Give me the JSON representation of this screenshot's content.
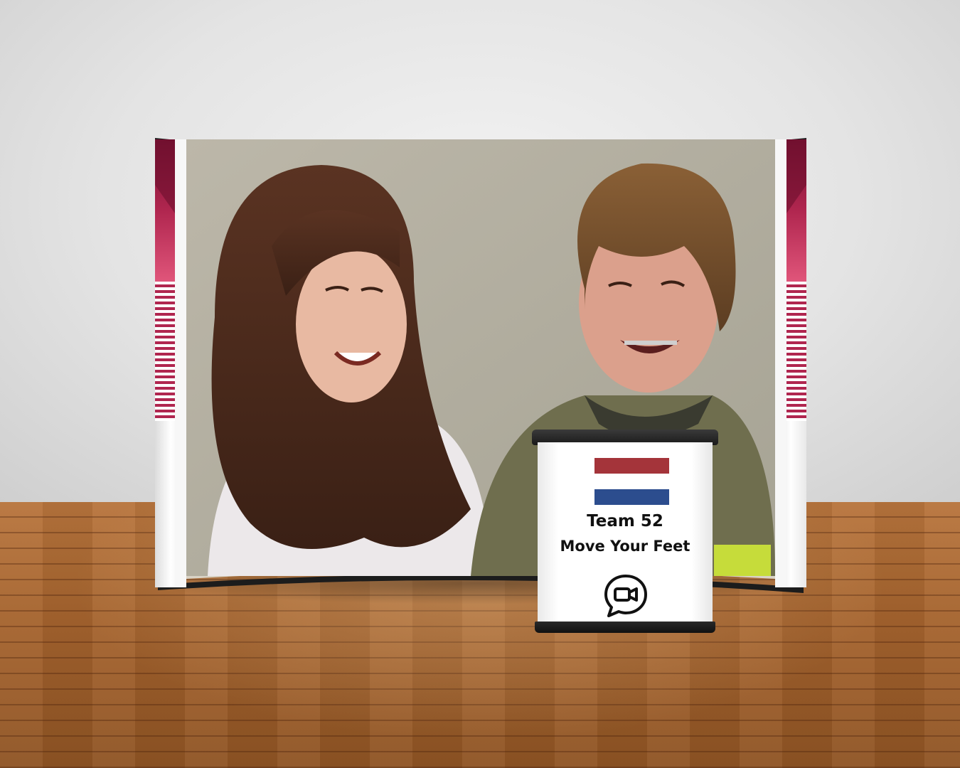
{
  "booth": {
    "team_name": "Team 52",
    "project_name": "Move Your Feet",
    "flag": {
      "top_color": "#a4343a",
      "middle_color": "#ffffff",
      "bottom_color": "#2c4d8e"
    },
    "accent_color": "#8e1a3e",
    "icon": "video-chat-icon"
  },
  "scene": {
    "wall_color": "#e4e4e4",
    "floor_color": "#a7652f"
  }
}
